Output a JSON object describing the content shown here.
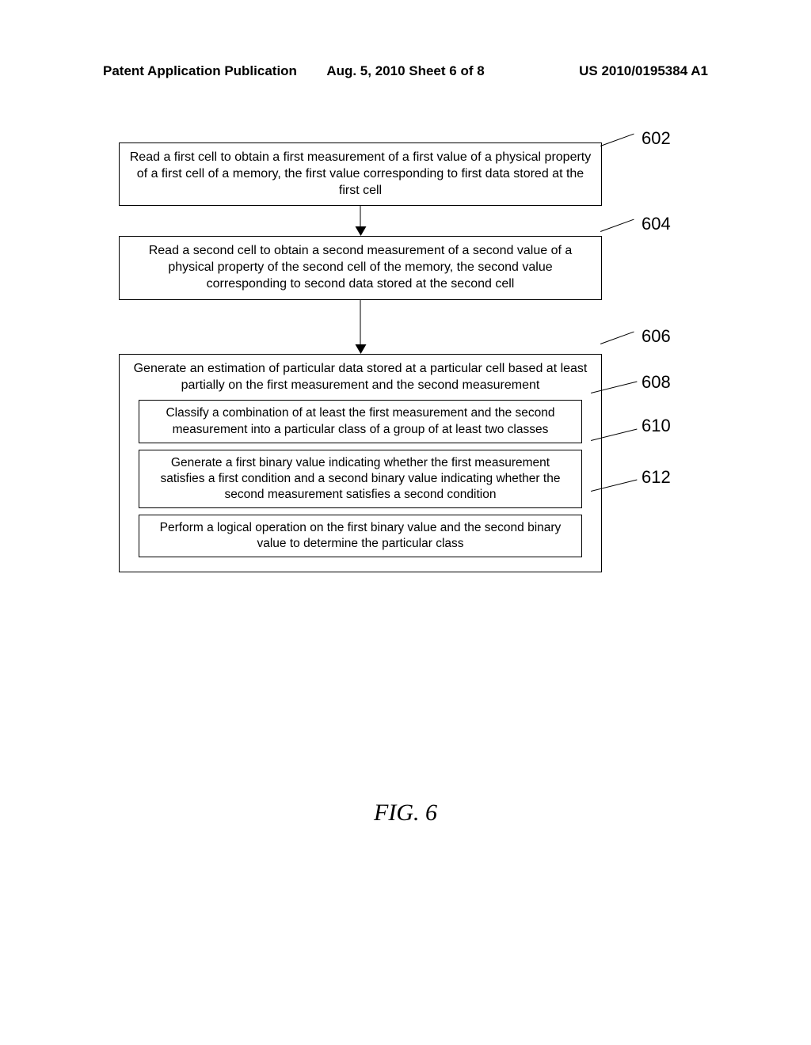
{
  "header": {
    "left": "Patent Application Publication",
    "center": "Aug. 5, 2010   Sheet 6 of 8",
    "right": "US 2010/0195384 A1"
  },
  "steps": {
    "s602": "Read a first cell to obtain a first measurement of a first value of a physical property of a first cell of a memory, the first value corresponding to first data stored at the  first cell",
    "s604": "Read a second cell to obtain a second measurement of a second value of a physical property of the second cell of the memory, the second value corresponding to second data stored at the second cell",
    "s606": "Generate an estimation of particular data stored at a particular cell based at least partially on the first measurement and the second measurement",
    "s608": "Classify a combination of at least the first measurement and the second measurement into a particular class of a group of at least two classes",
    "s610": "Generate a first binary value indicating whether the first measurement satisfies a first condition and a second binary value indicating whether the second measurement satisfies a second condition",
    "s612": "Perform a logical operation on the first binary value and the second binary value to determine the particular class"
  },
  "labels": {
    "l602": "602",
    "l604": "604",
    "l606": "606",
    "l608": "608",
    "l610": "610",
    "l612": "612"
  },
  "figure": "FIG. 6",
  "chart_data": {
    "type": "flowchart",
    "nodes": [
      {
        "id": "602",
        "text": "Read a first cell to obtain a first measurement of a first value of a physical property of a first cell of a memory, the first value corresponding to first data stored at the first cell"
      },
      {
        "id": "604",
        "text": "Read a second cell to obtain a second measurement of a second value of a physical property of the second cell of the memory, the second value corresponding to second data stored at the second cell"
      },
      {
        "id": "606",
        "text": "Generate an estimation of particular data stored at a particular cell based at least partially on the first measurement and the second measurement",
        "children": [
          "608",
          "610",
          "612"
        ]
      },
      {
        "id": "608",
        "text": "Classify a combination of at least the first measurement and the second measurement into a particular class of a group of at least two classes"
      },
      {
        "id": "610",
        "text": "Generate a first binary value indicating whether the first measurement satisfies a first condition and a second binary value indicating whether the second measurement satisfies a second condition"
      },
      {
        "id": "612",
        "text": "Perform a logical operation on the first binary value and the second binary value to determine the particular class"
      }
    ],
    "edges": [
      {
        "from": "602",
        "to": "604"
      },
      {
        "from": "604",
        "to": "606"
      }
    ],
    "figure_label": "FIG. 6",
    "header": {
      "publication": "Patent Application Publication",
      "date_sheet": "Aug. 5, 2010   Sheet 6 of 8",
      "patent_number": "US 2010/0195384 A1"
    }
  }
}
